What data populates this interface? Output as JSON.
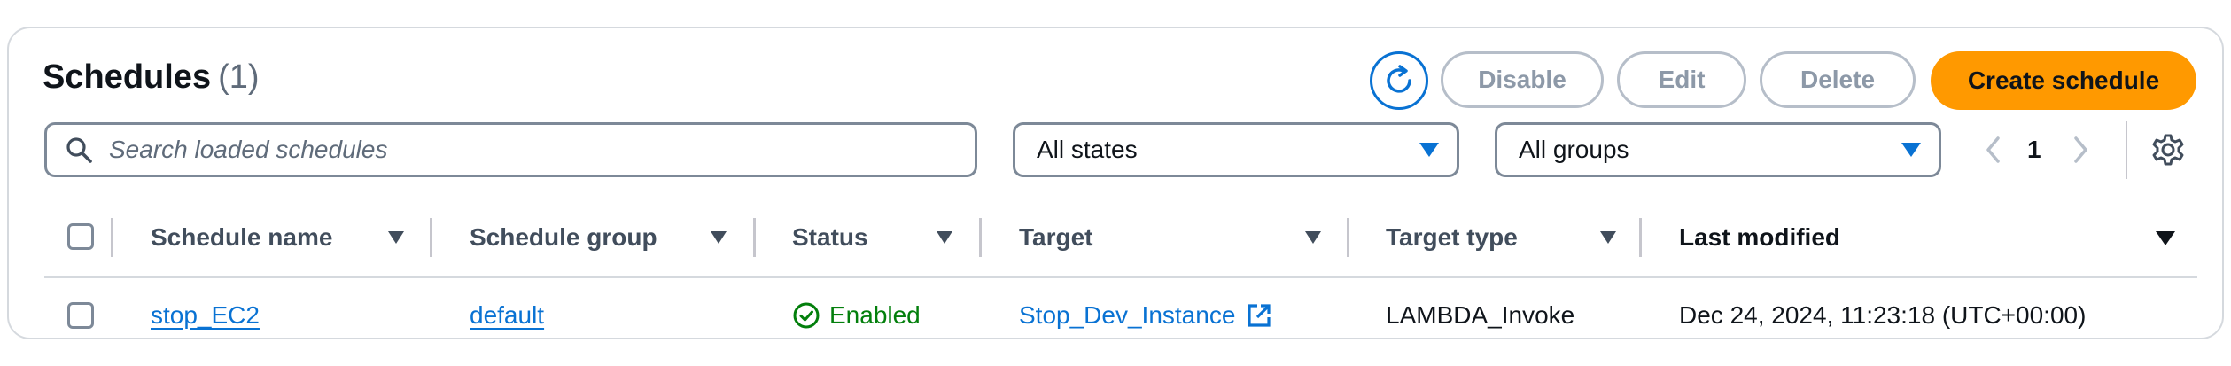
{
  "header": {
    "title": "Schedules",
    "count": "(1)"
  },
  "actions": {
    "refresh_icon": "refresh-icon",
    "disable_label": "Disable",
    "edit_label": "Edit",
    "delete_label": "Delete",
    "create_label": "Create schedule"
  },
  "filters": {
    "search_placeholder": "Search loaded schedules",
    "states_value": "All states",
    "groups_value": "All groups"
  },
  "pagination": {
    "current_page": "1"
  },
  "table": {
    "columns": [
      "Schedule name",
      "Schedule group",
      "Status",
      "Target",
      "Target type",
      "Last modified"
    ],
    "rows": [
      {
        "schedule_name": "stop_EC2",
        "schedule_group": "default",
        "status": "Enabled",
        "target": "Stop_Dev_Instance",
        "target_type": "LAMBDA_Invoke",
        "last_modified": "Dec 24, 2024, 11:23:18 (UTC+00:00)"
      }
    ]
  },
  "colors": {
    "primary": "#0972d3",
    "create_button": "#ff9900",
    "success": "#037f0c",
    "disabled_text": "#8d99a8"
  }
}
